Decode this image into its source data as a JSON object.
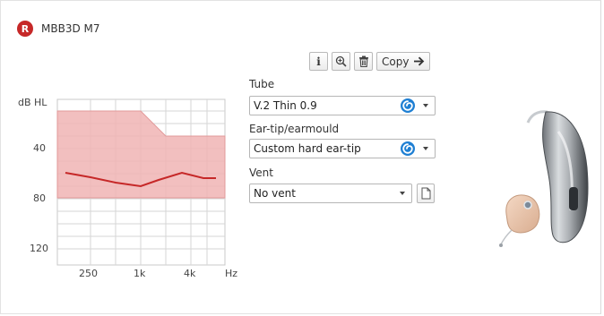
{
  "header": {
    "side_badge": "R",
    "device_name": "MBB3D M7"
  },
  "toolbar": {
    "info_icon": "info-icon",
    "zoom_icon": "zoom-in-icon",
    "delete_icon": "trash-icon",
    "copy_label": "Copy",
    "copy_icon": "arrow-right-icon"
  },
  "tube": {
    "label": "Tube",
    "value": "V.2 Thin 0.9",
    "icon": "swirl-icon"
  },
  "ear_tip": {
    "label": "Ear-tip/earmould",
    "value": "Custom hard ear-tip",
    "icon": "swirl-icon"
  },
  "vent": {
    "label": "Vent",
    "value": "No vent",
    "doc_icon": "document-icon"
  },
  "audiogram": {
    "y_axis_label": "dB HL",
    "y_ticks": [
      "40",
      "80",
      "120"
    ],
    "x_ticks": [
      "250",
      "1k",
      "4k"
    ],
    "x_unit": "Hz",
    "fitting_range_color": "#f0b4b4",
    "curve_color": "#c62828"
  },
  "device_image": {
    "description": "hearing-aid-device"
  }
}
